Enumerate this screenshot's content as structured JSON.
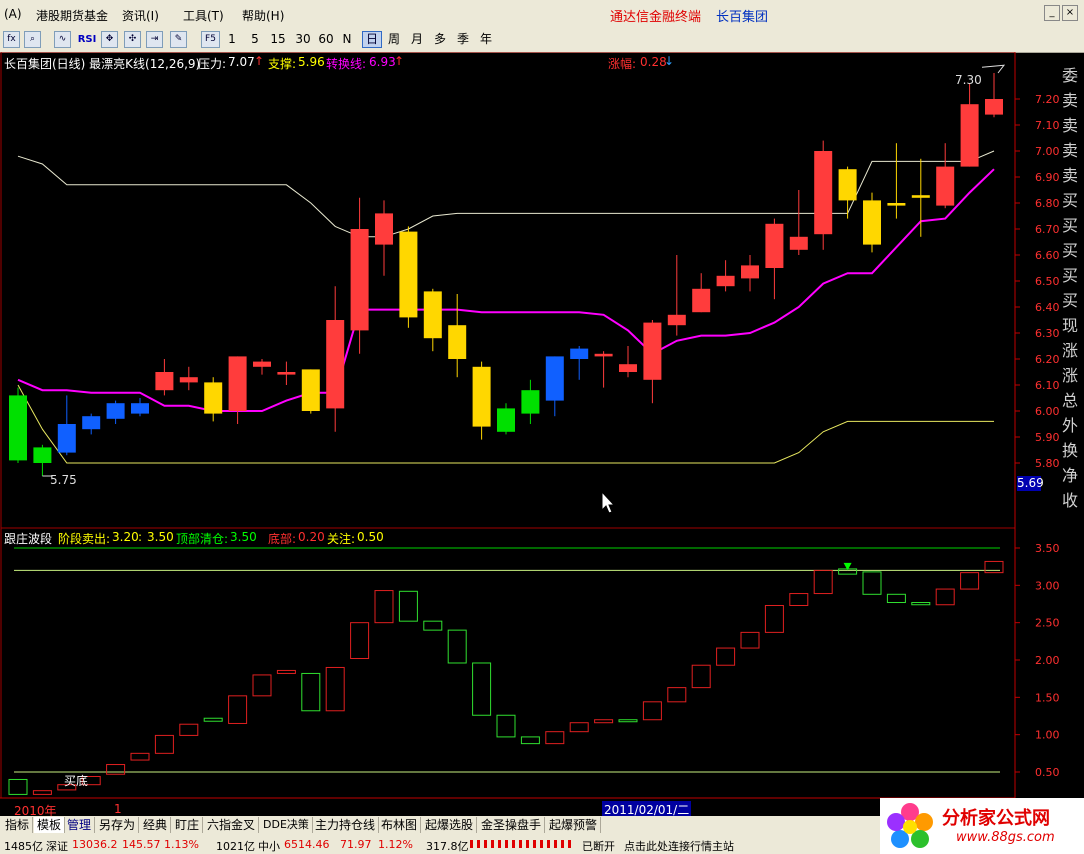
{
  "menu": {
    "sys_button": "(A)",
    "items": [
      "港股期货基金",
      "资讯(I)",
      "工具(T)",
      "帮助(H)"
    ],
    "ad_text": "通达信金融终端",
    "ad_stock": "长百集团"
  },
  "toolbar": {
    "periods": [
      "1",
      "5",
      "15",
      "30",
      "60",
      "N",
      "日",
      "周",
      "月",
      "多",
      "季",
      "年"
    ],
    "selected_period": "日",
    "f5_label": "F5",
    "rsi_label": "RSI"
  },
  "main": {
    "title": "长百集团(日线) 最漂亮K线(12,26,9)",
    "pressure_label": "压力:",
    "pressure_value": "7.07",
    "support_label": "支撑:",
    "support_value": "5.96",
    "switch_label": "转换线:",
    "switch_value": "6.93",
    "change_label": "涨幅:",
    "change_value": "0.28",
    "high_marker": "7.30",
    "low_marker": "5.75",
    "current_price": "5.69"
  },
  "right_side_labels": [
    "委",
    "卖",
    "卖",
    "卖",
    "卖",
    "买",
    "买",
    "买",
    "买",
    "买",
    "现",
    "涨",
    "涨",
    "总",
    "外",
    "换",
    "净",
    "收"
  ],
  "sub": {
    "title": "跟庄波段",
    "sell_label": "阶段卖出:",
    "sell_value": "3.20",
    "sell_value2": "3.50",
    "clear_label": "顶部清仓:",
    "clear_value": "3.50",
    "bottom_label": "底部:",
    "bottom_value": "0.20",
    "watch_label": "关注:",
    "watch_value": "0.50",
    "buy_bottom_text": "买底"
  },
  "timeline": {
    "year": "2010年",
    "month": "1",
    "date": "2011/02/01/二"
  },
  "tabs": [
    "指标",
    "模板",
    "管理",
    "另存为",
    "经典",
    "盯庄",
    "六指金叉",
    "DDE决策",
    "主力持仓线",
    "布林图",
    "起爆选股",
    "金圣操盘手",
    "起爆预警"
  ],
  "status": {
    "vol1": "1485亿",
    "index1_name": "深证",
    "index1_value": "13036.2",
    "index1_chg": "145.57",
    "index1_pct": "1.13%",
    "vol2": "1021亿",
    "index2_name": "中小",
    "index2_value": "6514.46",
    "index2_chg": "71.97",
    "index2_pct": "1.12%",
    "vol3": "317.8亿",
    "conn": "已断开",
    "hint": "点击此处连接行情主站"
  },
  "logo": {
    "text": "分析家公式网",
    "url": "www.88gs.com"
  },
  "chart_data": {
    "type": "candlestick",
    "y_axis_main": [
      "7.20",
      "7.10",
      "7.00",
      "6.90",
      "6.80",
      "6.70",
      "6.60",
      "6.50",
      "6.40",
      "6.30",
      "6.20",
      "6.10",
      "6.00",
      "5.90",
      "5.80"
    ],
    "y_axis_sub": [
      "3.50",
      "3.00",
      "2.50",
      "2.00",
      "1.50",
      "1.00",
      "0.50"
    ],
    "ylim_main": [
      5.69,
      7.35
    ],
    "ylim_sub": [
      0.0,
      3.8
    ],
    "candles": [
      {
        "o": 5.81,
        "c": 6.06,
        "h": 6.09,
        "l": 5.8,
        "col": "green"
      },
      {
        "o": 5.8,
        "c": 5.86,
        "h": 5.87,
        "l": 5.75,
        "col": "green"
      },
      {
        "o": 5.84,
        "c": 5.95,
        "h": 6.06,
        "l": 5.83,
        "col": "blue"
      },
      {
        "o": 5.93,
        "c": 5.98,
        "h": 5.99,
        "l": 5.91,
        "col": "blue"
      },
      {
        "o": 5.97,
        "c": 6.03,
        "h": 6.04,
        "l": 5.95,
        "col": "blue"
      },
      {
        "o": 5.99,
        "c": 6.03,
        "h": 6.05,
        "l": 5.98,
        "col": "blue"
      },
      {
        "o": 6.08,
        "c": 6.15,
        "h": 6.2,
        "l": 6.06,
        "col": "red"
      },
      {
        "o": 6.11,
        "c": 6.13,
        "h": 6.17,
        "l": 6.08,
        "col": "red"
      },
      {
        "o": 6.11,
        "c": 5.99,
        "h": 6.13,
        "l": 5.96,
        "col": "yellow"
      },
      {
        "o": 6.0,
        "c": 6.21,
        "h": 6.21,
        "l": 5.95,
        "col": "red"
      },
      {
        "o": 6.17,
        "c": 6.19,
        "h": 6.2,
        "l": 6.14,
        "col": "red"
      },
      {
        "o": 6.14,
        "c": 6.15,
        "h": 6.19,
        "l": 6.1,
        "col": "red"
      },
      {
        "o": 6.16,
        "c": 6.0,
        "h": 6.16,
        "l": 5.99,
        "col": "yellow"
      },
      {
        "o": 6.01,
        "c": 6.35,
        "h": 6.48,
        "l": 5.92,
        "col": "red"
      },
      {
        "o": 6.31,
        "c": 6.7,
        "h": 6.82,
        "l": 6.22,
        "col": "red"
      },
      {
        "o": 6.64,
        "c": 6.76,
        "h": 6.81,
        "l": 6.52,
        "col": "red"
      },
      {
        "o": 6.69,
        "c": 6.36,
        "h": 6.71,
        "l": 6.32,
        "col": "yellow"
      },
      {
        "o": 6.46,
        "c": 6.28,
        "h": 6.47,
        "l": 6.23,
        "col": "yellow"
      },
      {
        "o": 6.33,
        "c": 6.2,
        "h": 6.45,
        "l": 6.13,
        "col": "yellow"
      },
      {
        "o": 6.17,
        "c": 5.94,
        "h": 6.19,
        "l": 5.89,
        "col": "yellow"
      },
      {
        "o": 6.01,
        "c": 5.92,
        "h": 6.03,
        "l": 5.91,
        "col": "green"
      },
      {
        "o": 5.99,
        "c": 6.08,
        "h": 6.12,
        "l": 5.95,
        "col": "green"
      },
      {
        "o": 6.04,
        "c": 6.21,
        "h": 6.21,
        "l": 5.98,
        "col": "blue"
      },
      {
        "o": 6.2,
        "c": 6.24,
        "h": 6.25,
        "l": 6.12,
        "col": "blue"
      },
      {
        "o": 6.21,
        "c": 6.22,
        "h": 6.23,
        "l": 6.09,
        "col": "red"
      },
      {
        "o": 6.15,
        "c": 6.18,
        "h": 6.25,
        "l": 6.13,
        "col": "red"
      },
      {
        "o": 6.12,
        "c": 6.34,
        "h": 6.35,
        "l": 6.03,
        "col": "red"
      },
      {
        "o": 6.33,
        "c": 6.37,
        "h": 6.6,
        "l": 6.29,
        "col": "red"
      },
      {
        "o": 6.38,
        "c": 6.47,
        "h": 6.53,
        "l": 6.38,
        "col": "red"
      },
      {
        "o": 6.48,
        "c": 6.52,
        "h": 6.58,
        "l": 6.46,
        "col": "red"
      },
      {
        "o": 6.51,
        "c": 6.56,
        "h": 6.6,
        "l": 6.46,
        "col": "red"
      },
      {
        "o": 6.55,
        "c": 6.72,
        "h": 6.74,
        "l": 6.43,
        "col": "red"
      },
      {
        "o": 6.62,
        "c": 6.67,
        "h": 6.85,
        "l": 6.6,
        "col": "red"
      },
      {
        "o": 6.68,
        "c": 7.0,
        "h": 7.04,
        "l": 6.62,
        "col": "red"
      },
      {
        "o": 6.93,
        "c": 6.81,
        "h": 6.94,
        "l": 6.74,
        "col": "yellow"
      },
      {
        "o": 6.81,
        "c": 6.64,
        "h": 6.84,
        "l": 6.61,
        "col": "yellow"
      },
      {
        "o": 6.8,
        "c": 6.79,
        "h": 7.03,
        "l": 6.74,
        "col": "yellow"
      },
      {
        "o": 6.83,
        "c": 6.82,
        "h": 6.97,
        "l": 6.67,
        "col": "yellow"
      },
      {
        "o": 6.79,
        "c": 6.94,
        "h": 7.03,
        "l": 6.78,
        "col": "red"
      },
      {
        "o": 6.94,
        "c": 7.18,
        "h": 7.26,
        "l": 6.94,
        "col": "red"
      },
      {
        "o": 7.14,
        "c": 7.2,
        "h": 7.3,
        "l": 7.13,
        "col": "red"
      }
    ],
    "upper_line": [
      6.98,
      6.95,
      6.87,
      6.87,
      6.87,
      6.87,
      6.87,
      6.87,
      6.87,
      6.87,
      6.87,
      6.87,
      6.8,
      6.71,
      6.67,
      6.67,
      6.7,
      6.75,
      6.76,
      6.76,
      6.76,
      6.76,
      6.76,
      6.76,
      6.76,
      6.76,
      6.76,
      6.76,
      6.76,
      6.76,
      6.76,
      6.76,
      6.76,
      6.76,
      6.76,
      6.96,
      6.96,
      6.96,
      6.96,
      6.96,
      7.0
    ],
    "lower_line": [
      6.1,
      5.93,
      5.8,
      5.8,
      5.8,
      5.8,
      5.8,
      5.8,
      5.8,
      5.8,
      5.8,
      5.8,
      5.8,
      5.8,
      5.8,
      5.8,
      5.8,
      5.8,
      5.8,
      5.8,
      5.8,
      5.8,
      5.8,
      5.8,
      5.8,
      5.8,
      5.8,
      5.8,
      5.8,
      5.8,
      5.8,
      5.8,
      5.84,
      5.92,
      5.96,
      5.96,
      5.96,
      5.96,
      5.96,
      5.96,
      5.96
    ],
    "switch_line": [
      6.12,
      6.08,
      6.08,
      6.07,
      6.07,
      6.07,
      6.02,
      6.02,
      6.0,
      6.0,
      6.0,
      6.04,
      6.07,
      6.07,
      6.39,
      6.39,
      6.39,
      6.39,
      6.39,
      6.38,
      6.38,
      6.38,
      6.38,
      6.38,
      6.37,
      6.31,
      6.22,
      6.27,
      6.29,
      6.29,
      6.3,
      6.34,
      6.4,
      6.49,
      6.53,
      6.53,
      6.63,
      6.73,
      6.74,
      6.84,
      6.93
    ],
    "wave_bars": [
      {
        "lo": 0.2,
        "hi": 0.4,
        "col": "green"
      },
      {
        "lo": 0.2,
        "hi": 0.25,
        "col": "red"
      },
      {
        "lo": 0.26,
        "hi": 0.33,
        "col": "red"
      },
      {
        "lo": 0.33,
        "hi": 0.44,
        "col": "red"
      },
      {
        "lo": 0.47,
        "hi": 0.6,
        "col": "red"
      },
      {
        "lo": 0.66,
        "hi": 0.75,
        "col": "red"
      },
      {
        "lo": 0.75,
        "hi": 0.99,
        "col": "red"
      },
      {
        "lo": 0.99,
        "hi": 1.14,
        "col": "red"
      },
      {
        "lo": 1.18,
        "hi": 1.22,
        "col": "green"
      },
      {
        "lo": 1.15,
        "hi": 1.52,
        "col": "red"
      },
      {
        "lo": 1.52,
        "hi": 1.8,
        "col": "red"
      },
      {
        "lo": 1.82,
        "hi": 1.86,
        "col": "red"
      },
      {
        "lo": 1.32,
        "hi": 1.82,
        "col": "green"
      },
      {
        "lo": 1.32,
        "hi": 1.9,
        "col": "red"
      },
      {
        "lo": 2.02,
        "hi": 2.5,
        "col": "red"
      },
      {
        "lo": 2.5,
        "hi": 2.93,
        "col": "red"
      },
      {
        "lo": 2.52,
        "hi": 2.92,
        "col": "green"
      },
      {
        "lo": 2.4,
        "hi": 2.52,
        "col": "green"
      },
      {
        "lo": 1.96,
        "hi": 2.4,
        "col": "green"
      },
      {
        "lo": 1.26,
        "hi": 1.96,
        "col": "green"
      },
      {
        "lo": 0.97,
        "hi": 1.26,
        "col": "green"
      },
      {
        "lo": 0.88,
        "hi": 0.97,
        "col": "green"
      },
      {
        "lo": 0.88,
        "hi": 1.04,
        "col": "red"
      },
      {
        "lo": 1.04,
        "hi": 1.16,
        "col": "red"
      },
      {
        "lo": 1.16,
        "hi": 1.2,
        "col": "red"
      },
      {
        "lo": 1.18,
        "hi": 1.2,
        "col": "green"
      },
      {
        "lo": 1.2,
        "hi": 1.44,
        "col": "red"
      },
      {
        "lo": 1.44,
        "hi": 1.63,
        "col": "red"
      },
      {
        "lo": 1.63,
        "hi": 1.93,
        "col": "red"
      },
      {
        "lo": 1.93,
        "hi": 2.16,
        "col": "red"
      },
      {
        "lo": 2.16,
        "hi": 2.37,
        "col": "red"
      },
      {
        "lo": 2.37,
        "hi": 2.73,
        "col": "red"
      },
      {
        "lo": 2.73,
        "hi": 2.89,
        "col": "red"
      },
      {
        "lo": 2.89,
        "hi": 3.2,
        "col": "red"
      },
      {
        "lo": 3.15,
        "hi": 3.22,
        "col": "green"
      },
      {
        "lo": 2.88,
        "hi": 3.18,
        "col": "green"
      },
      {
        "lo": 2.77,
        "hi": 2.88,
        "col": "green"
      },
      {
        "lo": 2.74,
        "hi": 2.77,
        "col": "green"
      },
      {
        "lo": 2.74,
        "hi": 2.95,
        "col": "red"
      },
      {
        "lo": 2.95,
        "hi": 3.17,
        "col": "red"
      },
      {
        "lo": 3.17,
        "hi": 3.32,
        "col": "red"
      }
    ],
    "sub_levels": {
      "top_clear": 3.5,
      "sell": 3.2,
      "watch": 0.5,
      "bottom": 0.2
    },
    "colors": {
      "red": "#ff3c3c",
      "green": "#00e000",
      "blue": "#1060ff",
      "yellow": "#ffd700",
      "magenta": "#ff00ff",
      "axis": "#c00000"
    }
  }
}
